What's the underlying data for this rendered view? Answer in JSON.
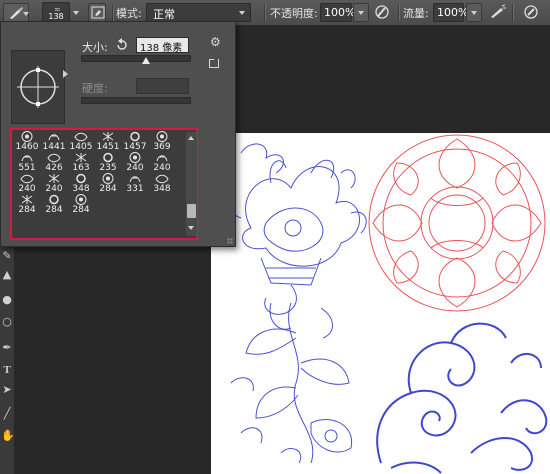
{
  "options_bar": {
    "tool_icon": "brush-icon",
    "brush_size": "138",
    "panel_toggle_icon": "brush-panel-icon",
    "mode_label": "模式:",
    "mode_value": "正常",
    "opacity_label": "不透明度:",
    "opacity_value": "100%",
    "pressure_opacity_icon": "pressure-opacity-icon",
    "flow_label": "流量:",
    "flow_value": "100%",
    "airbrush_icon": "airbrush-icon",
    "pressure_size_icon": "pressure-size-icon"
  },
  "brush_panel": {
    "size_label": "大小:",
    "size_value": "138 像素",
    "hardness_label": "硬度:",
    "hardness_value": "",
    "presets": [
      {
        "size": "1460"
      },
      {
        "size": "1441"
      },
      {
        "size": "1405"
      },
      {
        "size": "1451"
      },
      {
        "size": "1457"
      },
      {
        "size": "369"
      },
      {
        "size": "551"
      },
      {
        "size": "426"
      },
      {
        "size": "163"
      },
      {
        "size": "235"
      },
      {
        "size": "240"
      },
      {
        "size": "240"
      },
      {
        "size": "240"
      },
      {
        "size": "240"
      },
      {
        "size": "348"
      },
      {
        "size": "284"
      },
      {
        "size": "331"
      },
      {
        "size": "348"
      },
      {
        "size": "284"
      },
      {
        "size": "284"
      },
      {
        "size": "284"
      }
    ]
  },
  "colors": {
    "highlight_border": "#d6174a",
    "blue_brush": "#2a34c8",
    "red_brush": "#e8343a"
  }
}
